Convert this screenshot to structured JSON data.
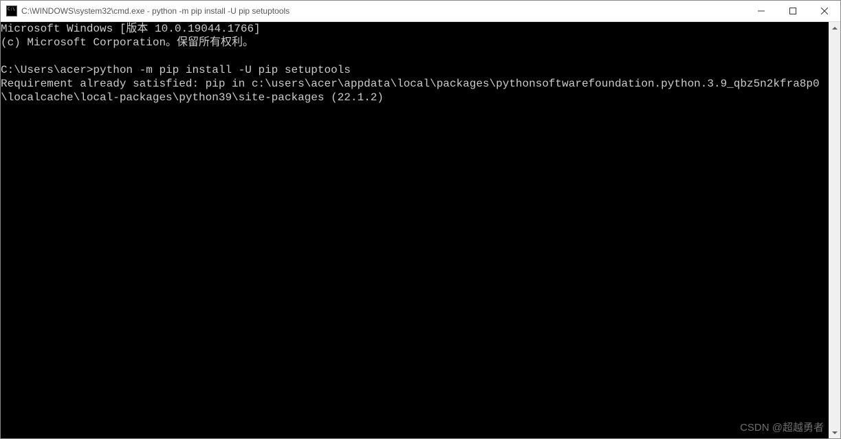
{
  "window": {
    "title": "C:\\WINDOWS\\system32\\cmd.exe - python  -m pip install -U pip setuptools"
  },
  "terminal": {
    "lines": [
      "Microsoft Windows [版本 10.0.19044.1766]",
      "(c) Microsoft Corporation。保留所有权利。",
      "",
      "C:\\Users\\acer>python -m pip install -U pip setuptools",
      "Requirement already satisfied: pip in c:\\users\\acer\\appdata\\local\\packages\\pythonsoftwarefoundation.python.3.9_qbz5n2kfra8p0\\localcache\\local-packages\\python39\\site-packages (22.1.2)"
    ]
  },
  "watermark": "CSDN @超越勇者"
}
